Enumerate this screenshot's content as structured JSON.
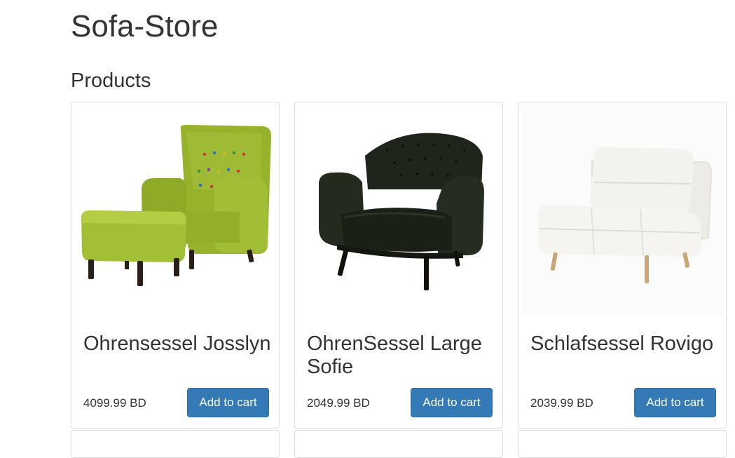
{
  "store": {
    "title": "Sofa-Store"
  },
  "section": {
    "title": "Products"
  },
  "products": [
    {
      "name": "Ohrensessel Josslyn",
      "price": "4099.99 BD",
      "button_label": "Add to cart",
      "color": "#9bb52e"
    },
    {
      "name": "OhrenSessel Large Sofie",
      "price": "2049.99 BD",
      "button_label": "Add to cart",
      "color": "#1c2217"
    },
    {
      "name": "Schlafsessel Rovigo",
      "price": "2039.99 BD",
      "button_label": "Add to cart",
      "color": "#f1f0ec"
    }
  ],
  "theme": {
    "primary_button": "#337ab7",
    "card_border": "#dddddd",
    "text": "#333333"
  }
}
